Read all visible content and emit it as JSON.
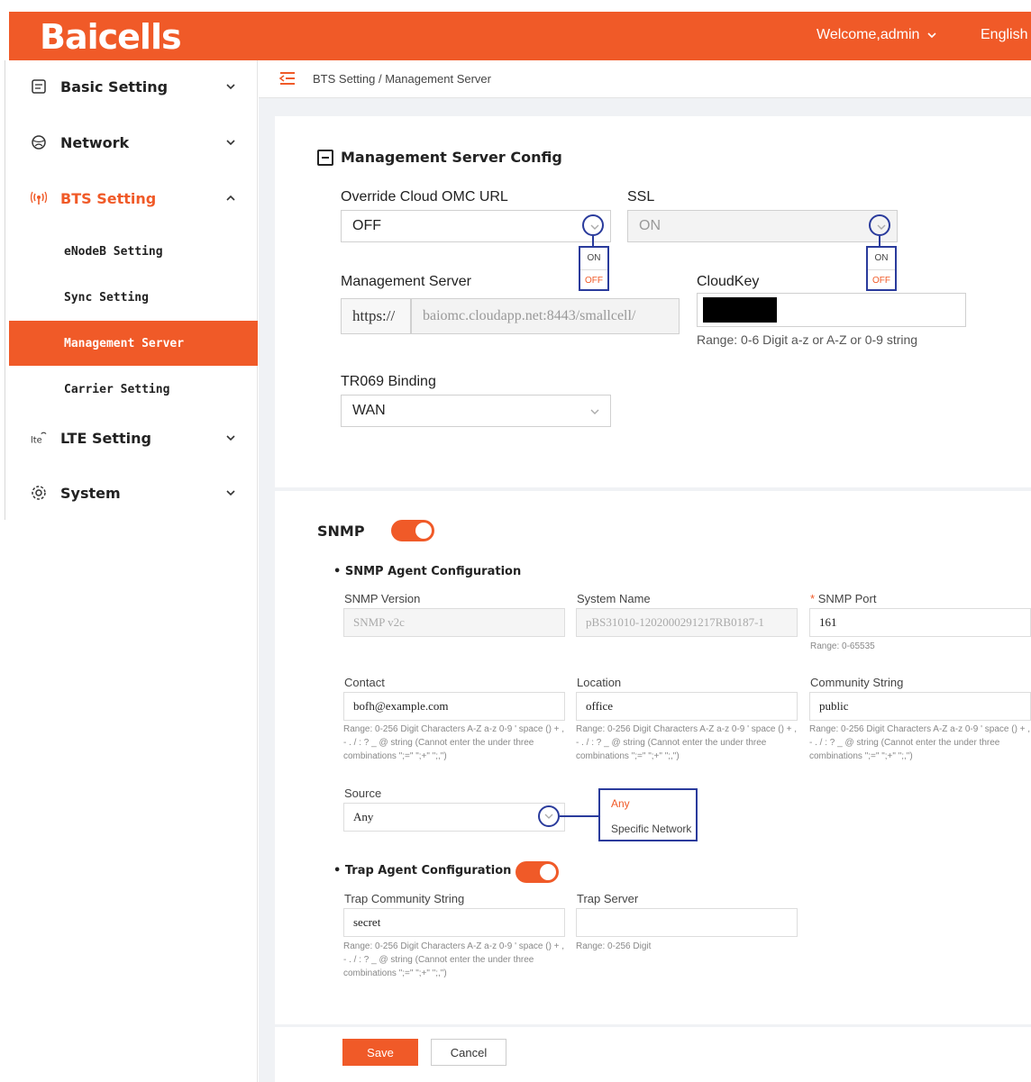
{
  "header": {
    "logo": "Baicells",
    "welcome": "Welcome,admin",
    "language": "English"
  },
  "sidebar": {
    "items": [
      {
        "label": "Basic Setting"
      },
      {
        "label": "Network"
      },
      {
        "label": "BTS Setting"
      },
      {
        "label": "LTE Setting"
      },
      {
        "label": "System"
      }
    ],
    "bts_sub": [
      {
        "label": "eNodeB Setting"
      },
      {
        "label": "Sync Setting"
      },
      {
        "label": "Management Server"
      },
      {
        "label": "Carrier Setting"
      }
    ]
  },
  "breadcrumb": "BTS Setting / Management Server",
  "mgmt": {
    "title": "Management Server Config",
    "override_label": "Override Cloud OMC URL",
    "override_value": "OFF",
    "ssl_label": "SSL",
    "ssl_value": "ON",
    "popup_on": "ON",
    "popup_off": "OFF",
    "server_label": "Management Server",
    "server_prefix": "https://",
    "server_url": "baiomc.cloudapp.net:8443/smallcell/",
    "cloudkey_label": "CloudKey",
    "cloudkey_hint": "Range: 0-6 Digit a-z or A-Z or 0-9 string",
    "tr069_label": "TR069 Binding",
    "tr069_value": "WAN"
  },
  "snmp": {
    "title": "SNMP",
    "agent_title": "SNMP Agent Configuration",
    "version_label": "SNMP Version",
    "version_value": "SNMP v2c",
    "sysname_label": "System Name",
    "sysname_value": "pBS31010-1202000291217RB0187-1",
    "port_req": "*",
    "port_label": "SNMP Port",
    "port_value": "161",
    "port_hint": "Range: 0-65535",
    "contact_label": "Contact",
    "contact_value": "bofh@example.com",
    "location_label": "Location",
    "location_value": "office",
    "community_label": "Community String",
    "community_value": "public",
    "text_hint": "Range: 0-256 Digit Characters A-Z a-z 0-9 ' space () + , - . / : ? _ @ string (Cannot enter the under three combinations \";=\" \";+\" \";,\")",
    "source_label": "Source",
    "source_value": "Any",
    "source_opt_any": "Any",
    "source_opt_specific": "Specific Network",
    "trap_title": "Trap Agent Configuration",
    "trap_comm_label": "Trap Community String",
    "trap_comm_value": "secret",
    "trap_server_label": "Trap Server",
    "trap_server_value": "",
    "trap_server_hint": "Range: 0-256 Digit"
  },
  "buttons": {
    "save": "Save",
    "cancel": "Cancel"
  },
  "colors": {
    "accent": "#f05a28",
    "annotation": "#2a3b9c"
  }
}
